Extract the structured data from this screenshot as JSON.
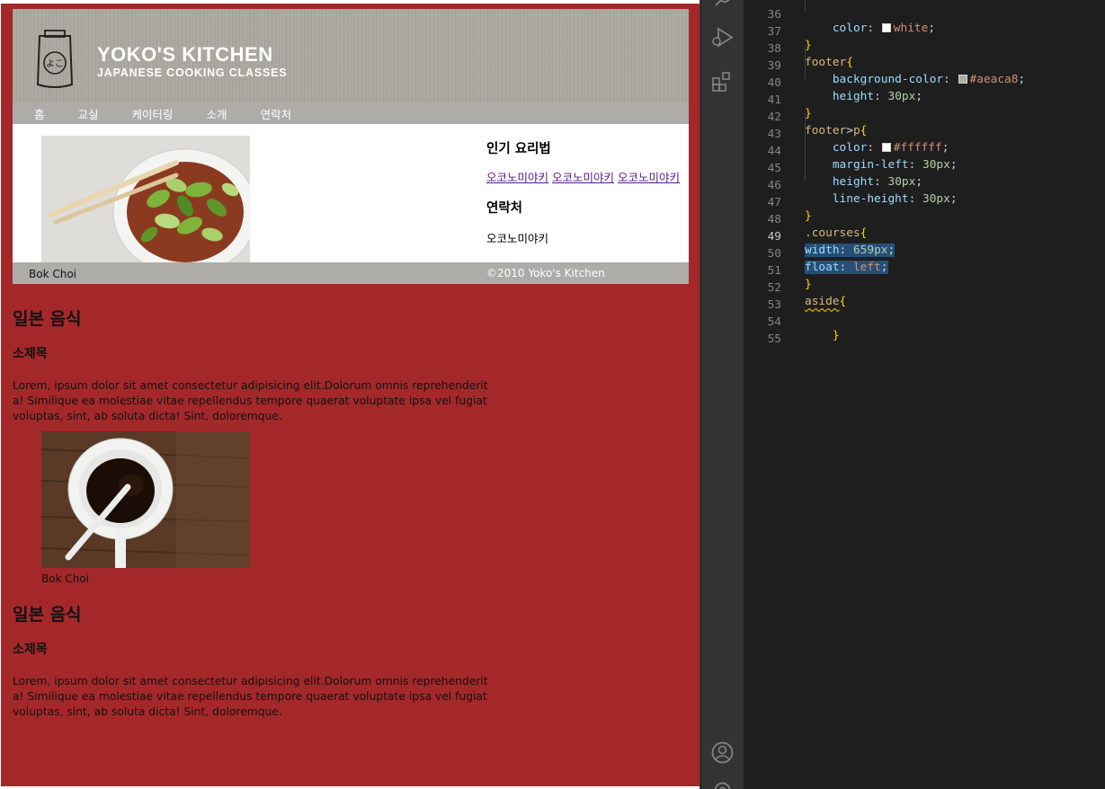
{
  "preview": {
    "header": {
      "logo_title": "YOKO'S KITCHEN",
      "logo_subtitle": "JAPANESE COOKING CLASSES",
      "logo_glyph": "よこ"
    },
    "nav": [
      "홈",
      "교실",
      "케이터링",
      "소개",
      "연락처"
    ],
    "figure1": {
      "caption": "Bok Choi"
    },
    "aside": {
      "heading1": "인기 요리법",
      "links": [
        "오코노미야키",
        "오코노미야키",
        "오코노미야키"
      ],
      "heading2": "연락처",
      "contact": "오코노미야키"
    },
    "footer": "©2010 Yoko's Kitchen",
    "courses": [
      {
        "title": "일본 음식",
        "subtitle": "소제목",
        "body": "Lorem, ipsum dolor sit amet consectetur adipisicing elit.Dolorum omnis reprehenderit a! Similique ea molestiae vitae repellendus tempore quaerat voluptate ipsa vel fugiat voluptas, sint, ab soluta dicta! Sint, doloremque."
      },
      {
        "title": "일본 음식",
        "subtitle": "소제목",
        "body": "Lorem, ipsum dolor sit amet consectetur adipisicing elit.Dolorum omnis reprehenderit a! Similique ea molestiae vitae repellendus tempore quaerat voluptate ipsa vel fugiat voluptas, sint, ab soluta dicta! Sint, doloremque."
      }
    ],
    "figure2": {
      "caption": "Bok Choi"
    },
    "colors": {
      "page_bg": "#a4282a",
      "nav_bg": "#aeaca8",
      "header_bg": "#aaa89f"
    }
  },
  "activity_bar": {
    "icons": [
      "search-icon",
      "run-debug-icon",
      "extensions-icon",
      "account-icon",
      "settings-icon"
    ]
  },
  "editor": {
    "active_line": 49,
    "lines": [
      {
        "n": "36",
        "t": "    color: white;"
      },
      {
        "n": "37",
        "t": "}"
      },
      {
        "n": "38",
        "t": "footer{"
      },
      {
        "n": "39",
        "t": "    background-color: #aeaca8;"
      },
      {
        "n": "40",
        "t": "    height: 30px;"
      },
      {
        "n": "41",
        "t": "}"
      },
      {
        "n": "42",
        "t": "footer>p{"
      },
      {
        "n": "43",
        "t": "    color: #ffffff;"
      },
      {
        "n": "44",
        "t": "    margin-left: 30px;"
      },
      {
        "n": "45",
        "t": "    height: 30px;"
      },
      {
        "n": "46",
        "t": "    line-height: 30px;"
      },
      {
        "n": "47",
        "t": "}"
      },
      {
        "n": "48",
        "t": ".courses{"
      },
      {
        "n": "49",
        "t": "width: 659px;"
      },
      {
        "n": "50",
        "t": "float: left;"
      },
      {
        "n": "51",
        "t": "}"
      },
      {
        "n": "52",
        "t": "aside{"
      },
      {
        "n": "53",
        "t": ""
      },
      {
        "n": "54",
        "t": "}"
      },
      {
        "n": "55",
        "t": ""
      }
    ]
  }
}
